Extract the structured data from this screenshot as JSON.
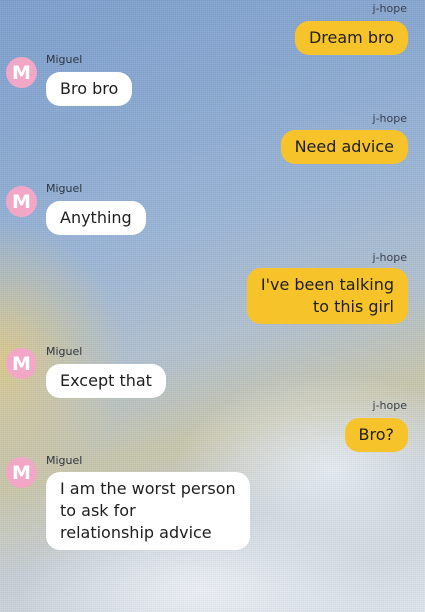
{
  "colors": {
    "outgoing_bubble": "#f7c32a",
    "incoming_bubble": "#ffffff",
    "avatar_background": "#f2a7c6"
  },
  "messages": [
    {
      "sender": "j-hope",
      "text": "Dream bro",
      "direction": "out"
    },
    {
      "sender": "Miguel",
      "avatar_letter": "M",
      "text": "Bro bro",
      "direction": "in"
    },
    {
      "sender": "j-hope",
      "text": "Need advice",
      "direction": "out"
    },
    {
      "sender": "Miguel",
      "avatar_letter": "M",
      "text": "Anything",
      "direction": "in"
    },
    {
      "sender": "j-hope",
      "text": "I've been talking\nto this girl",
      "direction": "out"
    },
    {
      "sender": "Miguel",
      "avatar_letter": "M",
      "text": "Except that",
      "direction": "in"
    },
    {
      "sender": "j-hope",
      "text": "Bro?",
      "direction": "out"
    },
    {
      "sender": "Miguel",
      "avatar_letter": "M",
      "text": "I am the worst person\nto ask for\nrelationship advice",
      "direction": "in"
    }
  ]
}
